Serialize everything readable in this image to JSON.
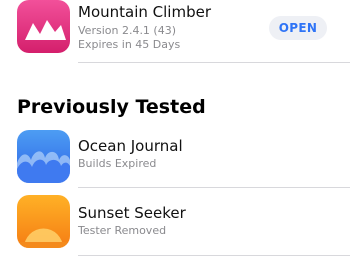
{
  "current_app": {
    "name": "Mountain Climber",
    "version": "Version 2.4.1 (43)",
    "expires": "Expires in 45 Days",
    "open_label": "OPEN",
    "icon": "mountain-icon"
  },
  "previously_tested": {
    "title": "Previously Tested",
    "apps": [
      {
        "name": "Ocean Journal",
        "status": "Builds Expired",
        "icon": "ocean-waves-icon"
      },
      {
        "name": "Sunset Seeker",
        "status": "Tester Removed",
        "icon": "sunset-icon"
      }
    ]
  },
  "colors": {
    "accent": "#2f74f6",
    "button_bg": "#eef0f5",
    "secondary_text": "#8a8a8e",
    "divider": "#d8d8dc"
  }
}
